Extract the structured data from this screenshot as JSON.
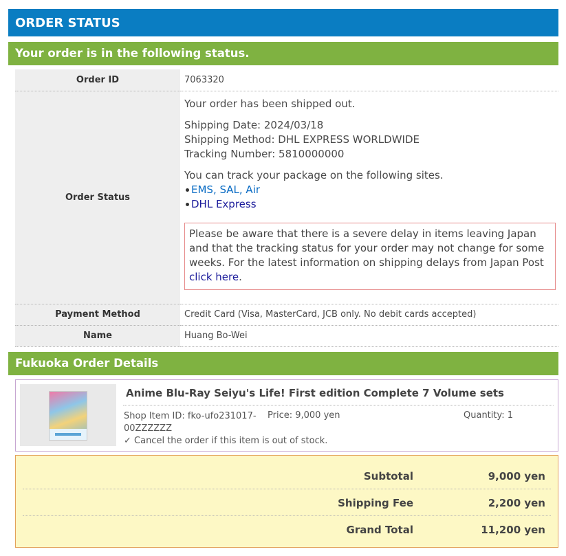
{
  "header": {
    "title": "ORDER STATUS"
  },
  "status_section": {
    "heading": "Your order is in the following status."
  },
  "order": {
    "id_label": "Order ID",
    "id_value": "7063320",
    "status_label": "Order Status",
    "status_text": "Your order has been shipped out.",
    "shipping_date": "Shipping Date: 2024/03/18",
    "shipping_method": "Shipping Method: DHL EXPRESS WORLDWIDE",
    "tracking_number": "Tracking Number: 5810000000",
    "track_intro": "You can track your package on the following sites.",
    "track_links": [
      "EMS, SAL, Air",
      "DHL Express"
    ],
    "delay_notice_text": "Please be aware that there is a severe delay in items leaving Japan and that the tracking status for your order may not change for some weeks. For the latest information on shipping delays from Japan Post ",
    "delay_notice_link": "click here",
    "delay_notice_end": ".",
    "payment_label": "Payment Method",
    "payment_value": "Credit Card (Visa, MasterCard, JCB only. No debit cards accepted)",
    "name_label": "Name",
    "name_value": "Huang Bo-Wei"
  },
  "details": {
    "heading": "Fukuoka Order Details",
    "item": {
      "title": "Anime Blu-Ray Seiyu's Life! First edition Complete 7 Volume sets",
      "shop_item_id": "Shop Item ID: fko-ufo231017-00ZZZZZZ",
      "price": "Price: 9,000 yen",
      "quantity": "Quantity: 1",
      "cancel_note": "✓ Cancel the order if this item is out of stock."
    }
  },
  "totals": {
    "subtotal_label": "Subtotal",
    "subtotal_value": "9,000 yen",
    "shipping_label": "Shipping Fee",
    "shipping_value": "2,200 yen",
    "grand_label": "Grand Total",
    "grand_value": "11,200 yen"
  },
  "colors": {
    "header_blue": "#0a7dc2",
    "section_green": "#7fb241",
    "totals_bg": "#fdf8c5",
    "link_blue": "#0a6cc4"
  }
}
